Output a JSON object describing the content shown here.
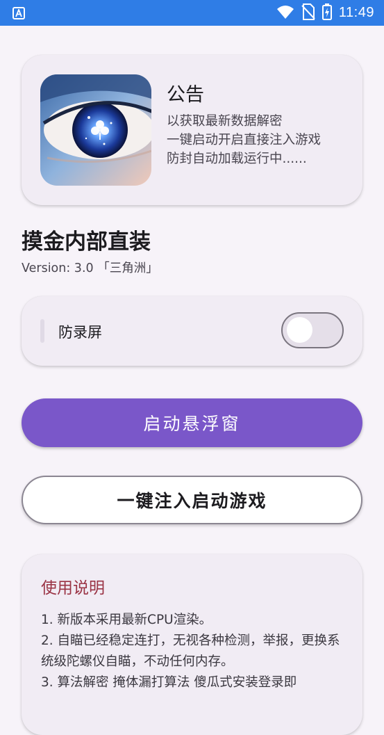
{
  "status_bar": {
    "time": "11:49",
    "icons": [
      "app-notification-icon",
      "wifi-icon",
      "no-sim-icon",
      "battery-charging-icon"
    ]
  },
  "notice": {
    "image_alt": "anime eye with clover",
    "title": "公告",
    "lines": [
      "以获取最新数据解密",
      "一键启动开启直接注入游戏",
      "防封自动加载运行中......"
    ]
  },
  "app": {
    "title": "摸金内部直装",
    "version": "Version: 3.0 「三角洲」"
  },
  "settings": {
    "anti_record_label": "防录屏",
    "anti_record_enabled": false
  },
  "buttons": {
    "start_float": "启动悬浮窗",
    "inject_start": "一键注入启动游戏"
  },
  "instructions": {
    "title": "使用说明",
    "lines": [
      "1. 新版本采用最新CPU渲染。",
      "2. 自瞄已经稳定连打，无视各种检测，举报，更换系统级陀螺仪自瞄，不动任何内存。",
      "3. 算法解密 掩体漏打算法 傻瓜式安装登录即"
    ]
  },
  "colors": {
    "status_bar": "#2f7de6",
    "background": "#f7f3f9",
    "card": "#f1ecf4",
    "primary": "#7a57c9",
    "instructions_title": "#9a3344"
  }
}
